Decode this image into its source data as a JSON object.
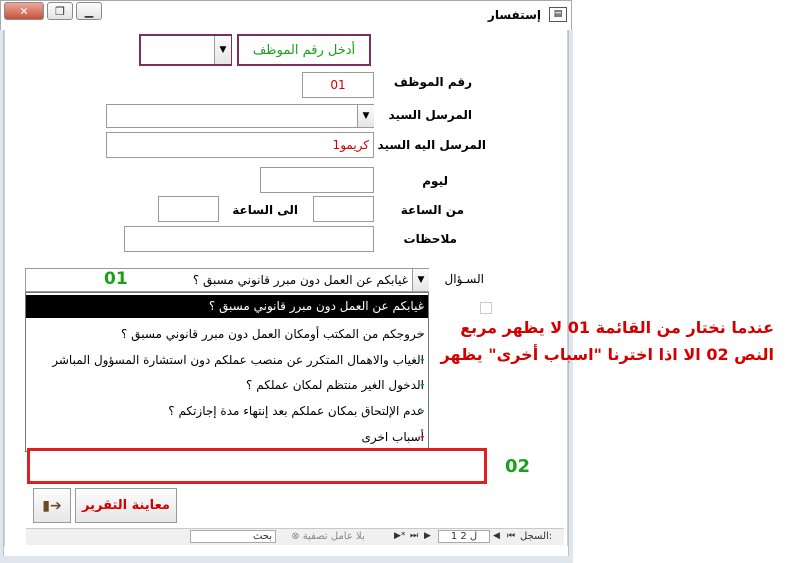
{
  "window": {
    "title": "إستفسار",
    "icon": "form-icon",
    "minimize_glyph": "▁",
    "restore_glyph": "❐",
    "close_glyph": "✕"
  },
  "header": {
    "employee_combo_value": "",
    "employee_number_prompt": "أدخل رقم الموظف"
  },
  "fields": {
    "employee_number_label": "رقم الموظف",
    "employee_number_value": "01",
    "sender_label": "المرسل السيد",
    "sender_value": "",
    "recipient_label": "المرسل اليه السيد",
    "recipient_value": "كريمو1",
    "day_label": "ليوم",
    "day_value": "",
    "from_time_label": "من الساعة",
    "from_time_value": "",
    "to_time_label": "الى الساعة",
    "to_time_value": "",
    "notes_label": "ملاحظات",
    "notes_value": ""
  },
  "question": {
    "label": "السـؤال",
    "selected": "غيابكم عن العمل دون مبرر قانوني مسبق ؟",
    "options": [
      "غيابكم عن العمل دون مبرر قانوني مسبق ؟",
      "خروجكم من المكتب أومكان العمل دون مبرر قانوني مسبق ؟",
      "الغياب والاهمال المتكرر عن منصب عملكم دون استشارة المسؤول المباشر",
      "الدخول الغير منتظم لمكان عملكم ؟",
      "عدم الإلتحاق بمكان عملكم بعد إنتهاء مدة إجازتكم ؟",
      "أسباب اخرى"
    ],
    "option_markers": [
      "-",
      "-",
      "-",
      "-",
      "-",
      "-"
    ],
    "other_reason_value": ""
  },
  "buttons": {
    "preview_report": "معاينة التقرير",
    "exit_icon": "exit-door-icon"
  },
  "navigation": {
    "record_label": "السجل:",
    "record_position": "1 ل 2",
    "filter_label": "بلا عامل تصفية",
    "search_label": "بحث"
  },
  "annotations": {
    "label_01_top": "01",
    "label_02": "02",
    "note": "عندما نختار من القائمة 01 لا يظهر مربع النص 02 الا اذا اخترنا \"اسباب أخرى\" يظهر"
  },
  "colors": {
    "annotation_red": "#d40000",
    "label_green": "#1aa01a",
    "highlight_box": "#7b2f5f",
    "red_box": "#e02020",
    "selected_row_bg": "#000000"
  }
}
